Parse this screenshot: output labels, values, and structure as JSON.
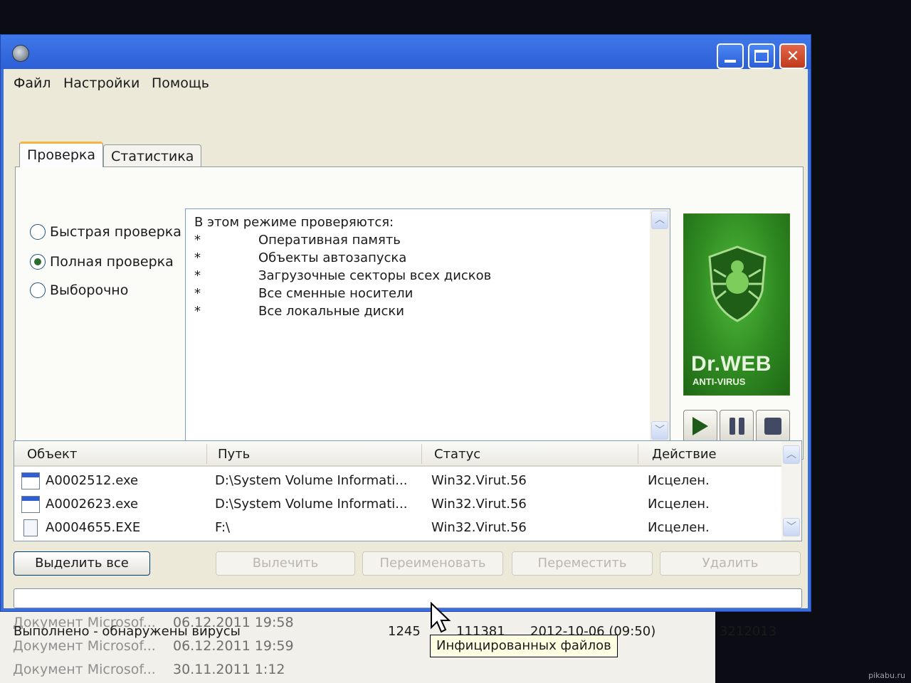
{
  "menu": {
    "items": [
      "Файл",
      "Настройки",
      "Помощь"
    ]
  },
  "tabs": [
    {
      "label": "Проверка",
      "selected": true
    },
    {
      "label": "Статистика",
      "selected": false
    }
  ],
  "scan_modes": [
    {
      "label": "Быстрая проверка",
      "selected": false
    },
    {
      "label": "Полная проверка",
      "selected": true
    },
    {
      "label": "Выборочно",
      "selected": false
    }
  ],
  "description": {
    "title": "В этом режиме проверяются:",
    "items": [
      "Оперативная память",
      "Объекты автозапуска",
      "Загрузочные секторы всех дисков",
      "Все сменные носители",
      "Все локальные диски"
    ],
    "bullet": "*"
  },
  "logo": {
    "name": "Dr.WEB",
    "subtitle": "ANTI-VIRUS",
    "icon": "drweb-spider-shield-icon",
    "color": "#2f8a21"
  },
  "controls": {
    "play_icon": "play-icon",
    "pause_icon": "pause-icon",
    "stop_icon": "stop-icon"
  },
  "results": {
    "columns": [
      "Объект",
      "Путь",
      "Статус",
      "Действие"
    ],
    "rows": [
      {
        "object": "A0002512.exe",
        "path": "D:\\System Volume Informati...",
        "status": "Win32.Virut.56",
        "action": "Исцелен.",
        "icon": "exe-file-icon"
      },
      {
        "object": "A0002623.exe",
        "path": "D:\\System Volume Informati...",
        "status": "Win32.Virut.56",
        "action": "Исцелен.",
        "icon": "exe-file-icon"
      },
      {
        "object": "A0004655.EXE",
        "path": "F:\\",
        "status": "Win32.Virut.56",
        "action": "Исцелен.",
        "icon": "document-file-icon"
      }
    ]
  },
  "buttons": {
    "select_all": "Выделить все",
    "cure": "Вылечить",
    "rename": "Переименовать",
    "move": "Переместить",
    "delete": "Удалить"
  },
  "progress": {
    "fraction": 0
  },
  "status": {
    "text": "Выполнено - обнаружены вирусы",
    "infected": "1245",
    "checked": "111381",
    "date": "2012-10-06 (09:50)",
    "code": "3212013"
  },
  "tooltip": "Инфицированных файлов",
  "background_list": [
    {
      "name": "Документ Microsof...",
      "date": "06.12.2011 19:58"
    },
    {
      "name": "Документ Microsof...",
      "date": "06.12.2011 19:59"
    },
    {
      "name": "Документ Microsof...",
      "date": "30.11.2011 1:12"
    }
  ],
  "watermark": "pikabu.ru",
  "colors": {
    "titlebar": "#2d5fd6",
    "close_button": "#c23a1c",
    "window_bg": "#ece9d8"
  }
}
